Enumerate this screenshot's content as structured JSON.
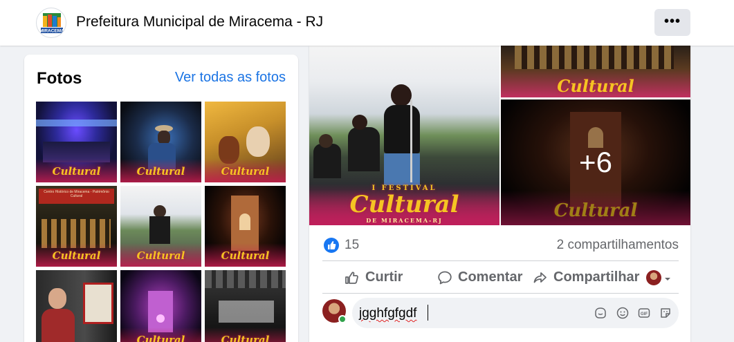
{
  "header": {
    "page_name": "Prefeitura Municipal de Miracema - RJ",
    "logo_text": "MIRACEMA",
    "more_icon": "ellipsis-icon",
    "more_label": "•••"
  },
  "photos": {
    "title": "Fotos",
    "see_all": "Ver todas as fotos",
    "festival_tag": "Cultural",
    "thumbnails": [
      {
        "name": "palco-show-azul"
      },
      {
        "name": "cantor-chapeu"
      },
      {
        "name": "danca-tradicional"
      },
      {
        "name": "centro-historico-apresentacao"
      },
      {
        "name": "cantor-violoes"
      },
      {
        "name": "igreja-noite"
      },
      {
        "name": "homem-exposicao"
      },
      {
        "name": "igreja-iluminada-roxa"
      },
      {
        "name": "salao-exposicao"
      }
    ],
    "sign_text": "Centro Histórico de Miracema - Patrimônio Cultural"
  },
  "post": {
    "festival_small": "I FESTIVAL",
    "festival_big": "Cultural",
    "festival_city": "DE MIRACEMA-RJ",
    "more_photos": "+6",
    "reactions": {
      "icon": "like-icon",
      "count": "15"
    },
    "shares": "2 compartilhamentos",
    "actions": [
      {
        "label": "Curtir",
        "icon": "thumbs-up-icon"
      },
      {
        "label": "Comentar",
        "icon": "comment-icon"
      },
      {
        "label": "Compartilhar",
        "icon": "share-icon"
      }
    ],
    "comment": {
      "value": "jgghfgfgdf",
      "icons": [
        "avatar-sticker-icon",
        "emoji-icon",
        "gif-icon",
        "sticker-icon"
      ]
    }
  },
  "colors": {
    "accent": "#1b74e4",
    "like_blue": "#1877f2",
    "muted": "#65676b",
    "online": "#31a24c",
    "festival_gold": "#f5c423"
  }
}
